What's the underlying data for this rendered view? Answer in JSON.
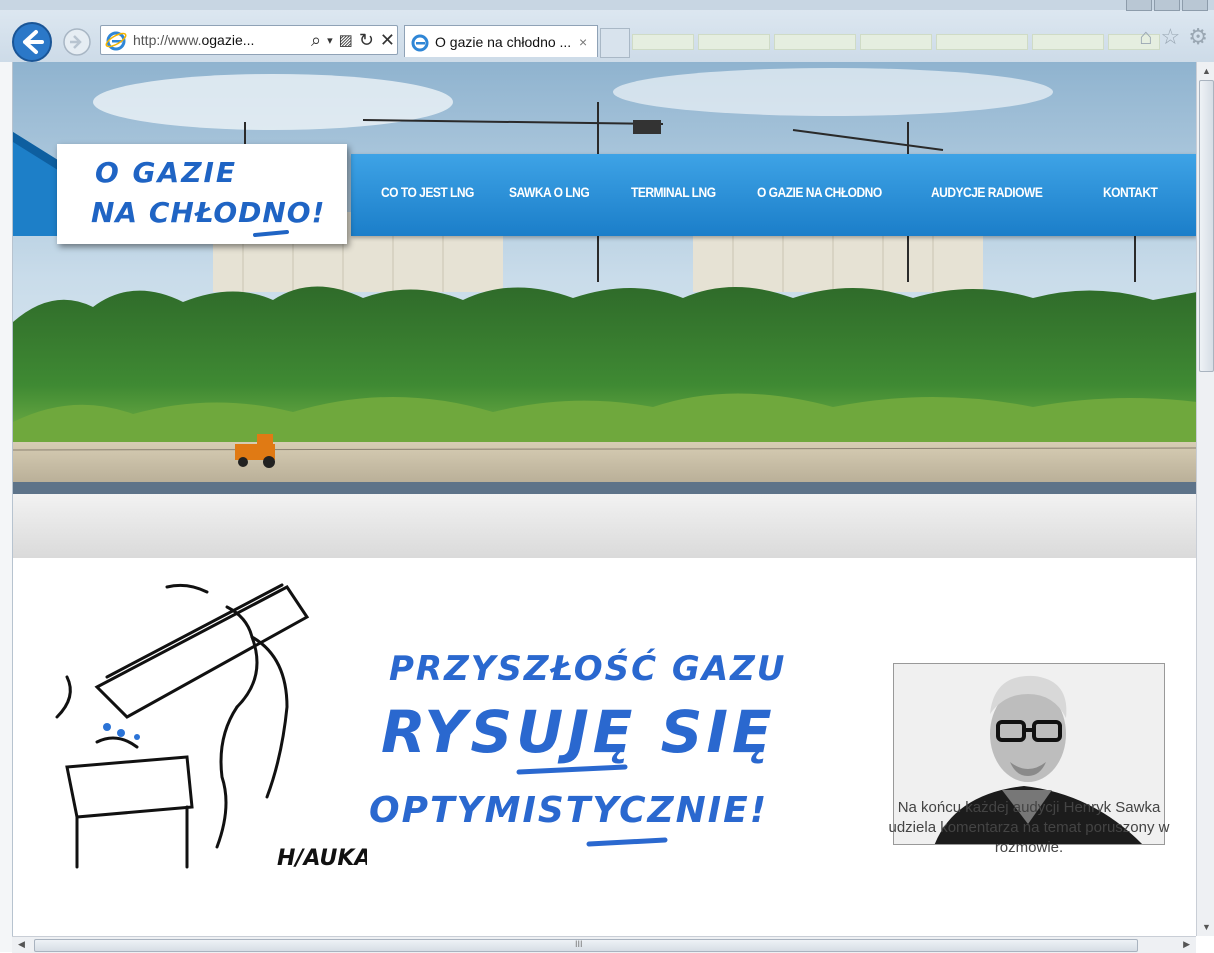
{
  "browser": {
    "address_prefix": "http://www.",
    "address_host": "ogazie...",
    "tab_title": "O gazie na chłodno ...",
    "tab_close": "×",
    "icons": [
      "back-icon",
      "forward-icon",
      "ie-logo-icon",
      "search-icon",
      "compat-icon",
      "refresh-icon",
      "stop-icon",
      "home-icon",
      "favorites-icon",
      "settings-icon"
    ]
  },
  "site": {
    "logo_line1": "O GAZIE",
    "logo_line2": "NA CHŁODNO!",
    "nav": [
      {
        "label": "CO TO JEST LNG"
      },
      {
        "label": "SAWKA O LNG"
      },
      {
        "label": "TERMINAL LNG"
      },
      {
        "label": "O GAZIE NA CHŁODNO"
      },
      {
        "label": "AUDYCJE RADIOWE"
      },
      {
        "label": "KONTAKT"
      }
    ],
    "accent": "#1b7ec9",
    "headline_line1": "PRZYSZŁOŚĆ GAZU",
    "headline_line2": "RYSUJĘ SIĘ",
    "headline_line3": "OPTYMISTYCZNIE!",
    "sketch_signature": "H/AUKA",
    "caption": "Na końcu każdej audycji Henryk Sawka udziela komentarza na temat poruszony w rozmowie."
  },
  "scrollbar": {
    "hscroll_mark": "III"
  }
}
